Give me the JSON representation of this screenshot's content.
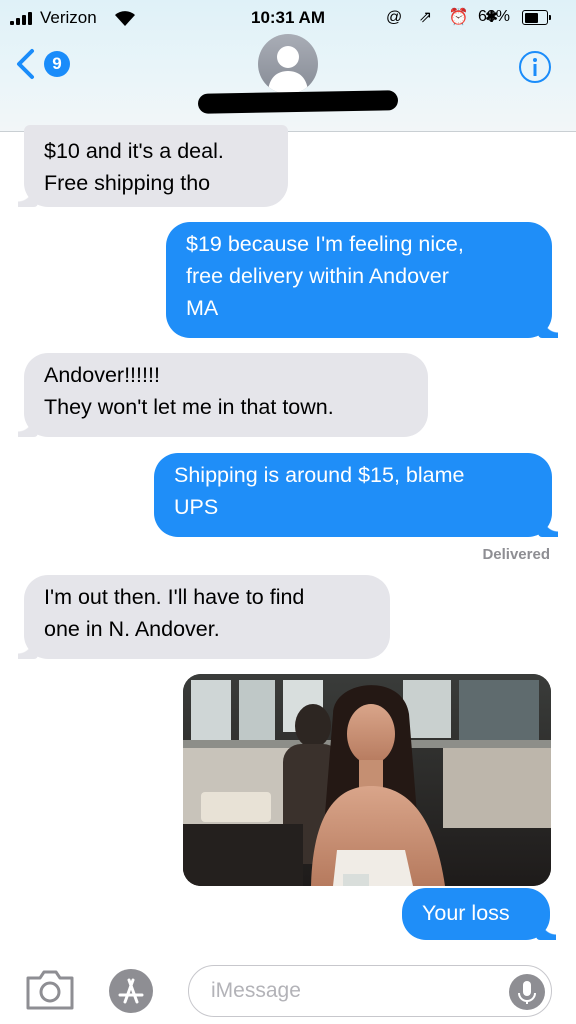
{
  "status_bar": {
    "carrier": "Verizon",
    "time": "10:31 AM",
    "icons": "@ ⇗ ⏰ ✱",
    "battery_percent": "68%"
  },
  "header": {
    "back_badge_count": "9",
    "back_icon": "chevron-left-icon",
    "avatar_icon": "person-silhouette-icon",
    "info_icon": "info-icon"
  },
  "messages": [
    {
      "sender": "them",
      "text": "$10 and it's a deal.\nFree shipping tho"
    },
    {
      "sender": "me",
      "text": "$19 because I'm feeling nice,\nfree delivery within Andover\nMA"
    },
    {
      "sender": "them",
      "text": "Andover!!!!!!\nThey won't let me in that town."
    },
    {
      "sender": "me",
      "text": "Shipping is around $15, blame\nUPS"
    },
    {
      "sender": "them",
      "text": "I'm out then. I'll have to find\none in N. Andover."
    },
    {
      "sender": "me",
      "text": "Your loss"
    }
  ],
  "delivered_label": "Delivered",
  "input_bar": {
    "placeholder": "iMessage",
    "camera_icon": "camera-icon",
    "apps_icon": "app-store-icon",
    "mic_icon": "microphone-icon"
  },
  "colors": {
    "sent_bubble": "#1f8ef8",
    "received_bubble": "#e5e5ea",
    "accent": "#1a8cfa"
  }
}
